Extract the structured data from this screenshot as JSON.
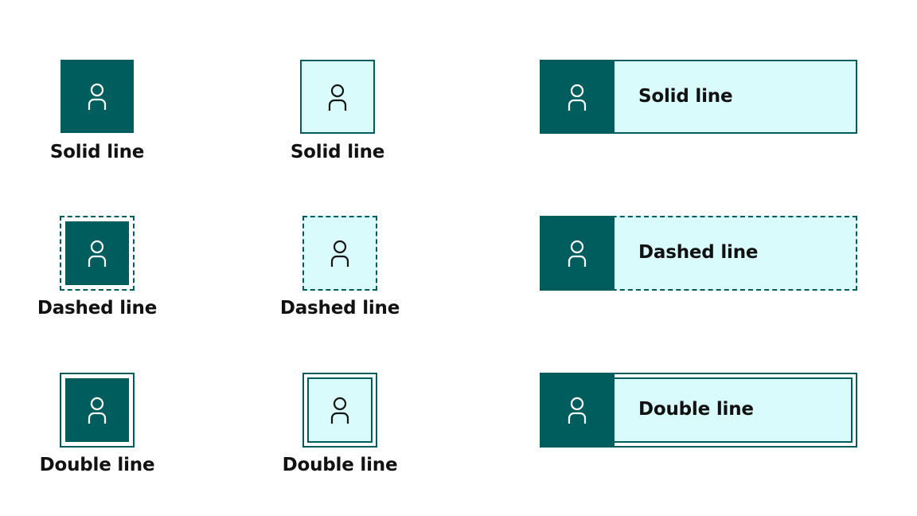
{
  "colors": {
    "dark_fill": "#005d5d",
    "light_fill": "#d9fbfb",
    "border": "#005d5d",
    "icon_on_dark": "#ffffff",
    "icon_on_light": "#161616",
    "text": "#111111"
  },
  "icon": "user-icon",
  "column_dark": {
    "items": [
      {
        "style": "solid",
        "label": "Solid line"
      },
      {
        "style": "dashed",
        "label": "Dashed line"
      },
      {
        "style": "double",
        "label": "Double line"
      }
    ]
  },
  "column_light": {
    "items": [
      {
        "style": "solid",
        "label": "Solid line"
      },
      {
        "style": "dashed",
        "label": "Dashed line"
      },
      {
        "style": "double",
        "label": "Double line"
      }
    ]
  },
  "column_wide": {
    "items": [
      {
        "style": "solid",
        "label": "Solid line"
      },
      {
        "style": "dashed",
        "label": "Dashed line"
      },
      {
        "style": "double",
        "label": "Double line"
      }
    ]
  }
}
